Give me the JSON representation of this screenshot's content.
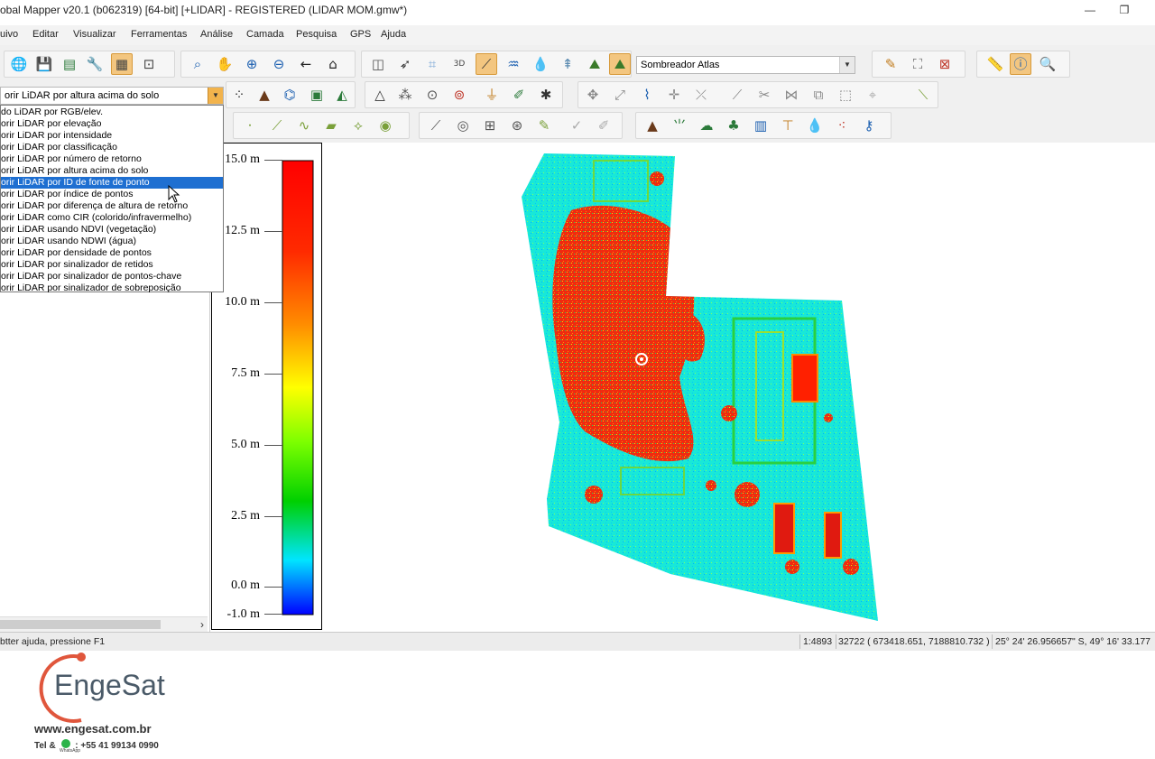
{
  "window": {
    "title": "obal Mapper v20.1 (b062319) [64-bit] [+LIDAR] - REGISTERED (LIDAR MOM.gmw*)"
  },
  "menu": [
    "uivo",
    "Editar",
    "Visualizar",
    "Ferramentas",
    "Análise",
    "Camada",
    "Pesquisa",
    "GPS",
    "Ajuda"
  ],
  "toolbar": {
    "shader_combo": "Sombreador Atlas",
    "lidar_combo": "orir LiDAR por altura acima do solo"
  },
  "lidar_dropdown": {
    "items": [
      "do LiDAR por RGB/elev.",
      "orir LiDAR por elevação",
      "orir LiDAR por intensidade",
      "orir LiDAR por classificação",
      "orir LiDAR por número de retorno",
      "orir LiDAR por altura acima do solo",
      "orir LiDAR por ID de fonte de ponto",
      "orir LiDAR por índice de pontos",
      "orir LiDAR por diferença de altura de retorno",
      "orir LiDAR como CIR (colorido/infravermelho)",
      "orir LiDAR usando NDVI (vegetação)",
      "orir LiDAR usando NDWI (água)",
      "orir LiDAR por densidade de pontos",
      "orir LiDAR por sinalizador de retidos",
      "orir LiDAR por sinalizador de pontos-chave",
      "orir LiDAR por sinalizador de sobreposição"
    ],
    "selected_index": 6
  },
  "legend": {
    "labels": [
      "15.0 m",
      "12.5 m",
      "10.0 m",
      "7.5 m",
      "5.0 m",
      "2.5 m",
      "0.0 m",
      "-1.0 m"
    ],
    "colors": {
      "top": "#ff0000",
      "mid_high": "#ff8c00",
      "mid": "#ffff00",
      "mid_low": "#7cff00",
      "green": "#00d000",
      "cyan": "#00e5ff",
      "bottom": "#0000ff"
    }
  },
  "branding": {
    "name": "EngeSat",
    "website": "www.engesat.com.br",
    "tel_label": "Tel &",
    "phone": ": +55 41 99134 0990",
    "whatsapp_caption": "WhatsApp"
  },
  "status": {
    "help": "btter ajuda, pressione F1",
    "scale": "1:4893",
    "coords": "32722 ( 673418.651, 7188810.732 )",
    "latlon": "25° 24' 26.956657\" S, 49° 16' 33.177"
  },
  "icons": {
    "toolbar1": [
      "globe-icon",
      "save-icon",
      "layer-control-icon",
      "wrench-icon",
      "overlay-control-icon",
      "config-icon",
      "zoom-box-icon",
      "pan-hand-icon",
      "zoom-in-icon",
      "zoom-out-icon",
      "back-icon",
      "home-icon",
      "split-icon",
      "pick-icon",
      "3d-box-icon",
      "3d-view-icon",
      "path-profile-icon",
      "water-level-icon",
      "water-icon",
      "tower-icon",
      "terrain-icon",
      "terrain-active-icon"
    ],
    "colors": {
      "accent_active": "#f3c680",
      "selection": "#1e6fd1"
    }
  }
}
